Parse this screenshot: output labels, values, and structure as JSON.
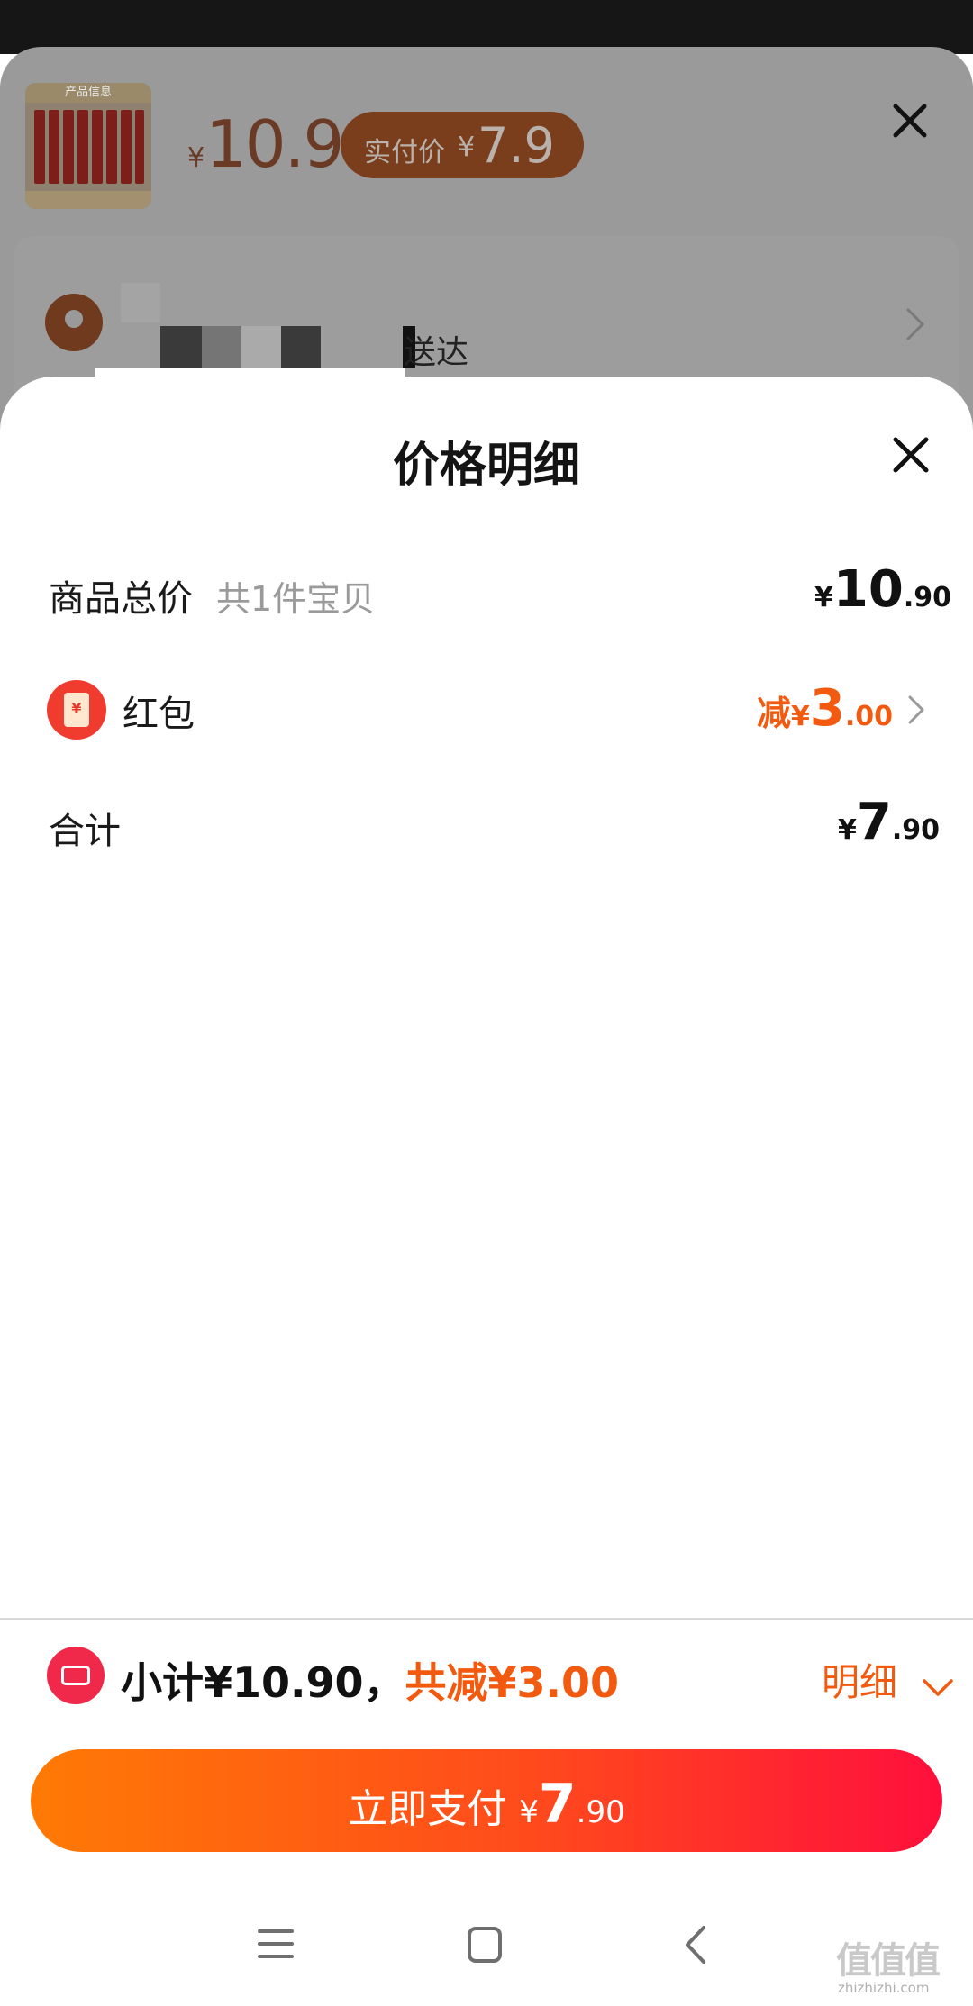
{
  "colors": {
    "accent": "#f25a10",
    "pay_gradient_start": "#ff7a05",
    "pay_gradient_end": "#ff0f3c",
    "red_icon": "#f03c2e"
  },
  "background": {
    "thumb_band_text": "产品信息",
    "price_currency": "¥",
    "price": "10.9",
    "actual_price_label": "实付价",
    "actual_price_currency": "¥",
    "actual_price": "7.9",
    "delivery_text": "送达",
    "close_icon": "close-icon",
    "chevron_icon": "chevron-right-icon"
  },
  "sheet": {
    "title": "价格明细",
    "close_icon": "close-icon",
    "rows": {
      "goods_total": {
        "label": "商品总价",
        "sub": "共1件宝贝",
        "currency": "¥",
        "int": "10",
        "dec": ".90"
      },
      "red_packet": {
        "label": "红包",
        "icon": "red-packet-icon",
        "icon_glyph": "¥",
        "prefix": "减",
        "currency": "¥",
        "int": "3",
        "dec": ".00",
        "chevron_icon": "chevron-right-icon"
      },
      "total": {
        "label": "合计",
        "currency": "¥",
        "int": "7",
        "dec": ".90"
      }
    }
  },
  "footer": {
    "coupon_icon": "coupon-icon",
    "subtotal": "小计¥10.90，",
    "discount": "共减¥3.00",
    "detail_label": "明细",
    "detail_icon": "chevron-down-icon",
    "pay_button": {
      "label": "立即支付",
      "currency": "¥",
      "int": "7",
      "dec": ".90"
    }
  },
  "system_nav": {
    "menu_icon": "menu-icon",
    "home_icon": "home-icon",
    "back_icon": "back-icon"
  },
  "watermark": {
    "text": "值值值",
    "sub": "zhizhizhi.com"
  }
}
